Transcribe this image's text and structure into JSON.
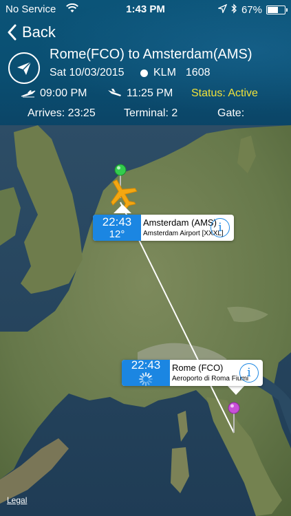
{
  "status_bar": {
    "carrier": "No Service",
    "time": "1:43 PM",
    "battery": "67%",
    "battery_level": 0.67
  },
  "header": {
    "back_label": "Back",
    "route": "Rome(FCO) to Amsterdam(AMS)",
    "date": "Sat 10/03/2015",
    "airline": "KLM",
    "flight_number": "1608",
    "departure_time": "09:00 PM",
    "arrival_time": "11:25 PM",
    "status": "Status: Active",
    "status_color": "#f1e23a",
    "arrives": "Arrives: 23:25",
    "terminal": "Terminal: 2",
    "gate": "Gate:"
  },
  "map": {
    "destination": {
      "time": "22:43",
      "temperature": "12°",
      "name": "Amsterdam (AMS)",
      "airport": "Amsterdam Airport [XXXL]"
    },
    "origin": {
      "time": "22:43",
      "name": "Rome (FCO)",
      "airport": "Aeroporto di Roma Fiumi"
    },
    "legal": "Legal",
    "accent_color": "#1b86e2"
  }
}
